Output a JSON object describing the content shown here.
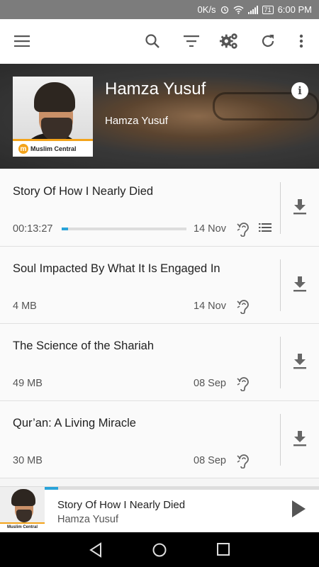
{
  "status_bar": {
    "net_speed": "0K/s",
    "battery": "71",
    "time": "6:00 PM"
  },
  "toolbar": {
    "icons": [
      "menu-icon",
      "search-icon",
      "filter-icon",
      "settings-icon",
      "refresh-icon",
      "more-vert-icon"
    ]
  },
  "podcast": {
    "title": "Hamza Yusuf",
    "author": "Hamza Yusuf",
    "artwork_logo_text": "Muslim Central",
    "info_label": "i"
  },
  "episodes": [
    {
      "title": "Story Of How I Nearly Died",
      "meta": "00:13:27",
      "date": "14 Nov",
      "progress": 0.05,
      "in_queue": true
    },
    {
      "title": "Soul Impacted By What It Is Engaged In",
      "meta": "4 MB",
      "date": "14 Nov"
    },
    {
      "title": "The Science of the Shariah",
      "meta": "49 MB",
      "date": "08 Sep"
    },
    {
      "title": "Qur’an: A Living Miracle",
      "meta": "30 MB",
      "date": "08 Sep"
    }
  ],
  "player": {
    "title": "Story Of How I Nearly Died",
    "author": "Hamza Yusuf",
    "progress": 0.05,
    "logo_text": "Muslim Central"
  },
  "colors": {
    "accent": "#29a3d9",
    "brand": "#f3a31a",
    "status_bar": "#7c7c7c"
  }
}
